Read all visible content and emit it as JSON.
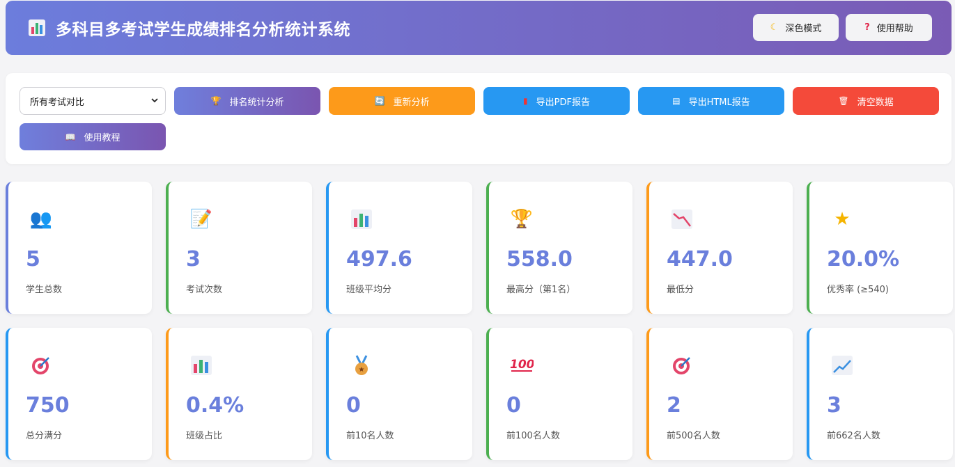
{
  "header": {
    "title": "多科目多考试学生成绩排名分析统计系统",
    "dark_mode_label": "深色模式",
    "help_label": "使用帮助"
  },
  "toolbar": {
    "select_value": "所有考试对比",
    "rank_btn": "排名统计分析",
    "reanalyze_btn": "重新分析",
    "pdf_btn": "导出PDF报告",
    "html_btn": "导出HTML报告",
    "clear_btn": "清空数据",
    "tutorial_btn": "使用教程"
  },
  "colors": {
    "accent": "#6a7fdc",
    "green": "#4caf50",
    "blue": "#2798f2",
    "orange": "#fd9a1a",
    "red": "#f44a3a"
  },
  "stats": [
    {
      "value": "5",
      "label": "学生总数",
      "icon": "people-icon"
    },
    {
      "value": "3",
      "label": "考试次数",
      "icon": "memo-icon"
    },
    {
      "value": "497.6",
      "label": "班级平均分",
      "icon": "bar-chart-icon"
    },
    {
      "value": "558.0",
      "label": "最高分（第1名）",
      "icon": "trophy-icon"
    },
    {
      "value": "447.0",
      "label": "最低分",
      "icon": "chart-decreasing-icon"
    },
    {
      "value": "20.0%",
      "label": "优秀率 (≥540)",
      "icon": "star-icon"
    },
    {
      "value": "750",
      "label": "总分满分",
      "icon": "target-icon"
    },
    {
      "value": "0.4%",
      "label": "班级占比",
      "icon": "bar-chart-icon"
    },
    {
      "value": "0",
      "label": "前10名人数",
      "icon": "medal-icon"
    },
    {
      "value": "0",
      "label": "前100名人数",
      "icon": "hundred-icon"
    },
    {
      "value": "2",
      "label": "前500名人数",
      "icon": "target-icon"
    },
    {
      "value": "3",
      "label": "前662名人数",
      "icon": "chart-increasing-icon"
    }
  ]
}
